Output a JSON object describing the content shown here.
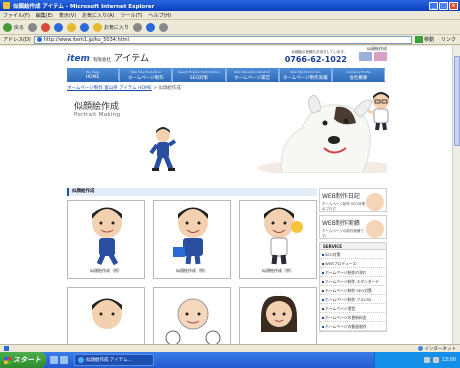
{
  "window": {
    "title": "似顔絵作成 アイテム - Microsoft Internet Explorer"
  },
  "menu": [
    "ファイル(F)",
    "編集(E)",
    "表示(V)",
    "お気に入り(A)",
    "ツール(T)",
    "ヘルプ(H)"
  ],
  "toolbar": {
    "back": "戻る",
    "favorites": "お気に入り"
  },
  "address": {
    "label": "アドレス(D)",
    "url": "http://www.item1.jp/ku_5034.html",
    "go": "移動",
    "links": "リンク"
  },
  "site": {
    "top_link": "似顔絵作成",
    "logo_brand": "item",
    "logo_co": "有限会社",
    "logo_name": "アイテム",
    "contact_label": "似顔絵の依頼もお待ちしています。",
    "tel": "0766-62-1022",
    "nav": [
      {
        "en": "Top Page",
        "jp": "HOME"
      },
      {
        "en": "Web Site Production",
        "jp": "ホームページ制作"
      },
      {
        "en": "Search Engine Optimization",
        "jp": "SEO対策"
      },
      {
        "en": "Web Site Administration",
        "jp": "ホームページ運営"
      },
      {
        "en": "Web Site Production",
        "jp": "ホームページ制作実績"
      },
      {
        "en": "Company Profile",
        "jp": "会社概要"
      }
    ],
    "breadcrumb_link": "ホームページ制作 富山県 アイテム HOME",
    "breadcrumb_sep": " > ",
    "breadcrumb_current": "似顔絵作成",
    "hero_title": "似顔絵作成",
    "hero_subtitle": "Portrait Making",
    "section_title": "似顔絵作成",
    "cards": [
      {
        "caption": "似顔絵作成（例）"
      },
      {
        "caption": "似顔絵作成（例）"
      },
      {
        "caption": "似顔絵作成（例）"
      },
      {
        "caption": ""
      },
      {
        "caption": ""
      },
      {
        "caption": ""
      }
    ],
    "side_boxes": [
      {
        "title": "WEB制作日記",
        "desc": "ホームページ制作 SEO対策のブログ"
      },
      {
        "title": "WEB制作実績",
        "desc": "ホームページの制作実績です。"
      }
    ],
    "service_title": "SERVICE",
    "services": [
      "SEO対策",
      "WEBプロデュース",
      "ホームページ制作の流れ",
      "ホームページ制作 スタンダード",
      "ホームページ制作 SEO対策",
      "ホームページ制作 フルCSS",
      "ホームページ運営",
      "ホームページの更新料金",
      "ホームページの動画制作"
    ]
  },
  "status": {
    "zone": "インターネット"
  },
  "taskbar": {
    "start": "スタート",
    "task": "似顔絵作成 アイテム...",
    "time": "13:00"
  }
}
